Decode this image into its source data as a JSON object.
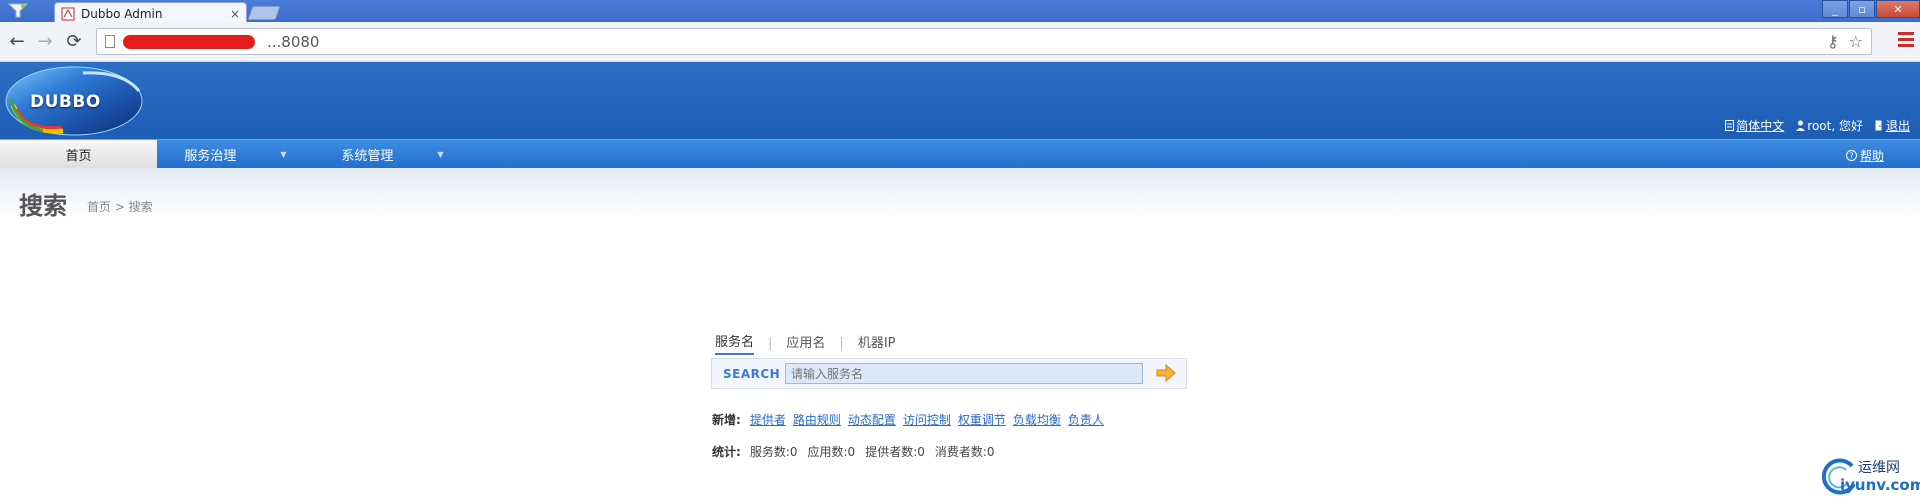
{
  "browser": {
    "tab_title": "Dubbo Admin",
    "tab_close": "×",
    "url": "...8080",
    "win_min": "_",
    "win_max": "▫",
    "win_close": "✕"
  },
  "header": {
    "logo_text": "DUBBO",
    "language_link": "简体中文",
    "user_greeting": "root, 您好",
    "logout_link": "退出"
  },
  "menu": {
    "items": [
      {
        "label": "首页",
        "active": true
      },
      {
        "label": "服务治理",
        "active": false
      },
      {
        "label": "系统管理",
        "active": false
      }
    ],
    "caret": "▼",
    "help_link": "帮助"
  },
  "page": {
    "title": "搜索",
    "breadcrumb": "首页 > 搜索"
  },
  "search": {
    "tabs": [
      "服务名",
      "应用名",
      "机器IP"
    ],
    "separator": "|",
    "label": "SEARCH",
    "placeholder": "请输入服务名"
  },
  "new_row": {
    "label": "新增:",
    "links": [
      "提供者",
      "路由规则",
      "动态配置",
      "访问控制",
      "权重调节",
      "负载均衡",
      "负责人"
    ]
  },
  "stats_row": {
    "label": "统计:",
    "items": [
      "服务数:0",
      "应用数:0",
      "提供者数:0",
      "消费者数:0"
    ]
  },
  "watermark": {
    "cn": "运维网",
    "domain": "iyunv.com"
  },
  "colors": {
    "header_blue": "#1c5db5",
    "menu_blue": "#2270cd",
    "link_blue": "#2a6bc4"
  }
}
